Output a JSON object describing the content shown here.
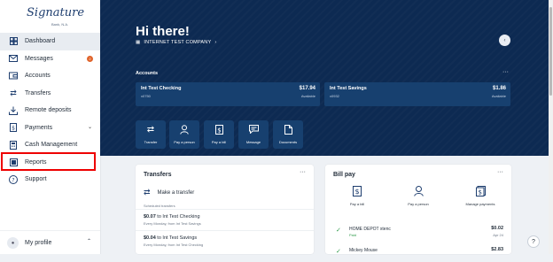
{
  "brand": {
    "logo_text": "Signature",
    "logo_sub": "Bank, N.A."
  },
  "sidebar": {
    "items": [
      {
        "label": "Dashboard",
        "icon": "dashboard-icon",
        "active": true
      },
      {
        "label": "Messages",
        "icon": "mail-icon",
        "badge": "2"
      },
      {
        "label": "Accounts",
        "icon": "accounts-icon"
      },
      {
        "label": "Transfers",
        "icon": "transfer-icon"
      },
      {
        "label": "Remote deposits",
        "icon": "deposit-icon"
      },
      {
        "label": "Payments",
        "icon": "payments-icon",
        "expandable": true
      },
      {
        "label": "Cash Management",
        "icon": "cash-management-icon"
      },
      {
        "label": "Reports",
        "icon": "reports-icon",
        "highlighted": true
      },
      {
        "label": "Support",
        "icon": "support-icon"
      }
    ],
    "profile_label": "My profile"
  },
  "hero": {
    "greeting": "Hi there!",
    "company": "INTERNET TEST COMPANY",
    "accounts_title": "Accounts",
    "accounts": [
      {
        "name": "Int Test Checking",
        "number": "x0750",
        "amount": "$17.94",
        "amount_label": "Available"
      },
      {
        "name": "Int Test Savings",
        "number": "x0932",
        "amount": "$1.86",
        "amount_label": "Available"
      }
    ],
    "quick_actions": [
      {
        "label": "Transfer",
        "icon": "transfer-icon"
      },
      {
        "label": "Pay a person",
        "icon": "person-icon"
      },
      {
        "label": "Pay a bill",
        "icon": "bill-icon"
      },
      {
        "label": "Message",
        "icon": "message-icon"
      },
      {
        "label": "Documents",
        "icon": "document-icon"
      }
    ]
  },
  "transfers": {
    "title": "Transfers",
    "make_label": "Make a transfer",
    "scheduled_label": "Scheduled transfers",
    "rows": [
      {
        "amount": "$0.07",
        "text": "to Int Test Checking",
        "sub": "Every Monday, from Int Test Savings"
      },
      {
        "amount": "$0.04",
        "text": "to Int Test Savings",
        "sub": "Every Monday, from Int Test Checking"
      }
    ]
  },
  "billpay": {
    "title": "Bill pay",
    "options": [
      {
        "label": "Pay a bill",
        "icon": "bill-icon"
      },
      {
        "label": "Pay a person",
        "icon": "person-icon"
      },
      {
        "label": "Manage payments",
        "icon": "manage-payments-icon"
      }
    ],
    "payments": [
      {
        "payee": "HOME DEPOT xtenc",
        "status": "Paid",
        "amount": "$0.02",
        "date": "Apr 24"
      },
      {
        "payee": "Mickey Mouse",
        "status": "",
        "amount": "$2.83",
        "date": ""
      }
    ]
  },
  "ui": {
    "more": "···",
    "help": "?"
  }
}
